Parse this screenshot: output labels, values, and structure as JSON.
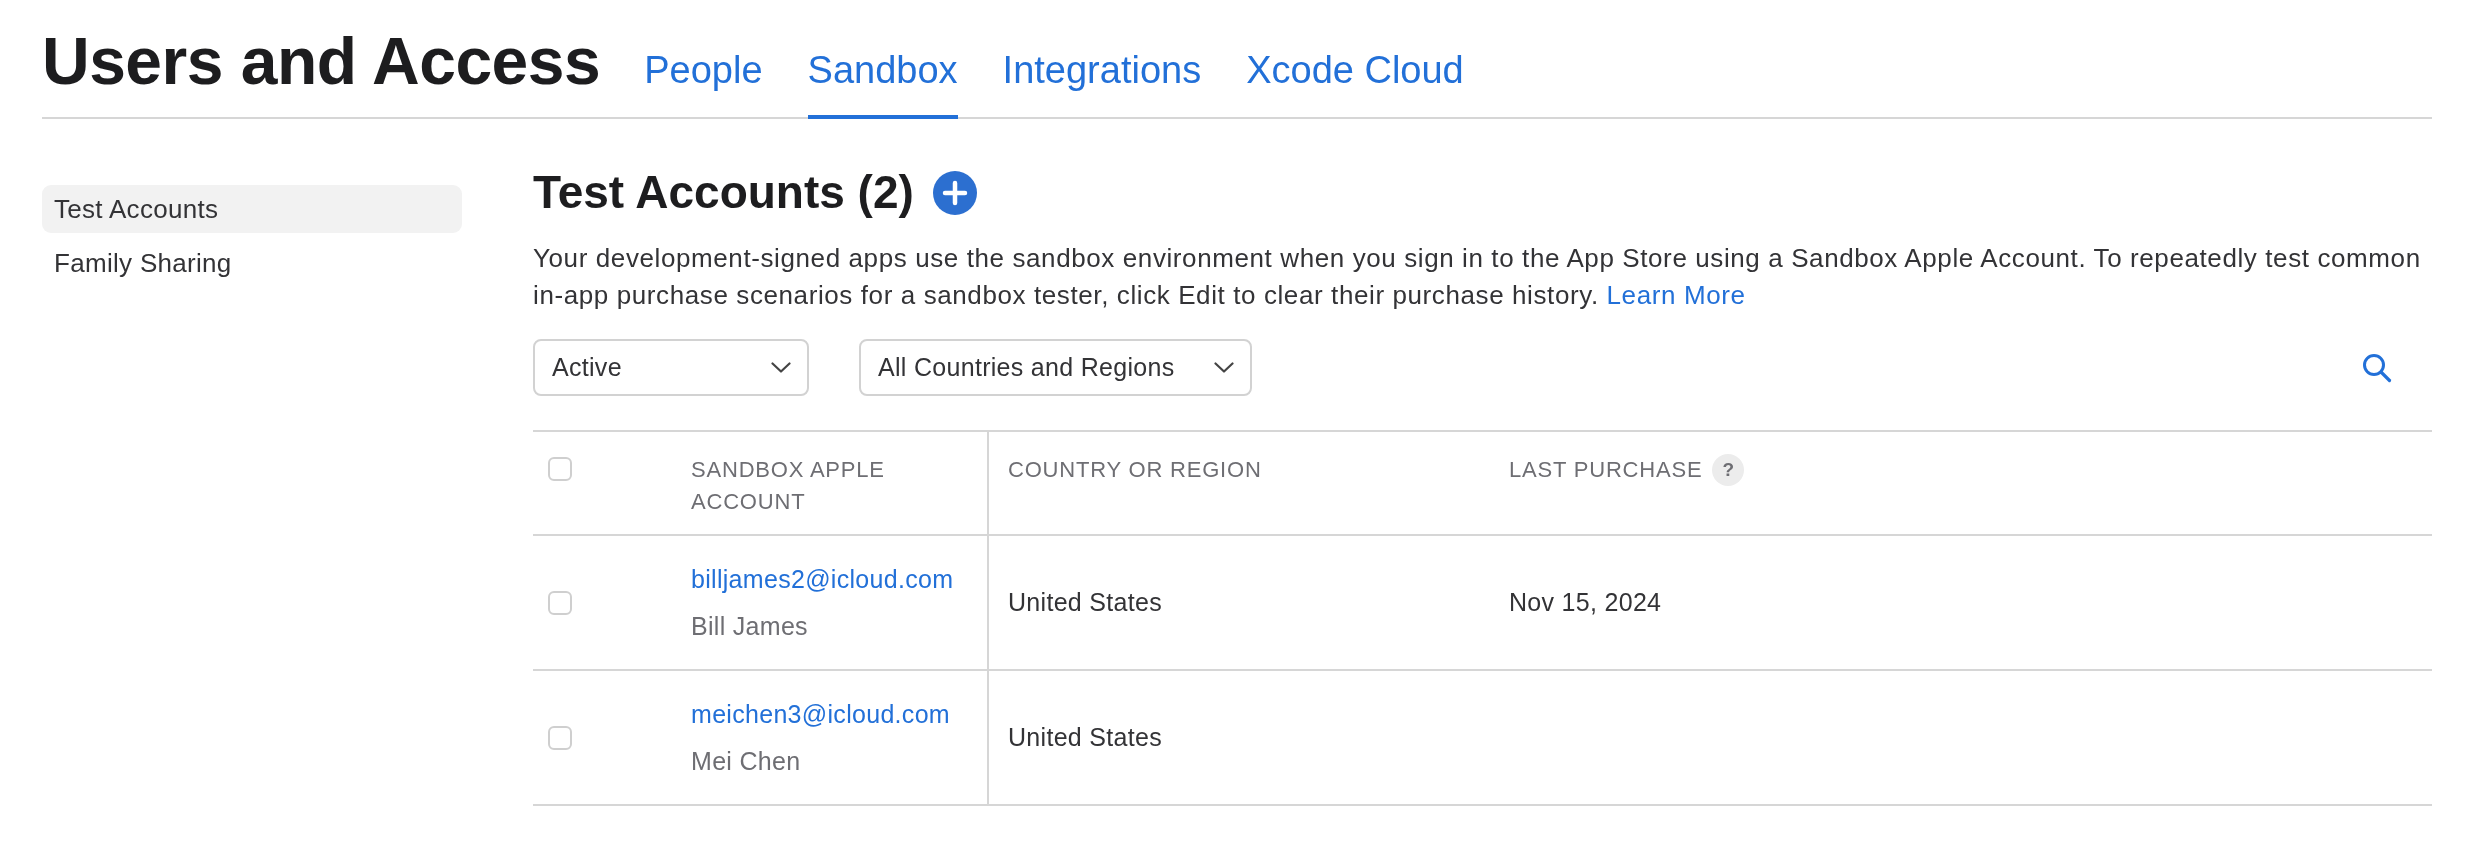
{
  "header": {
    "title": "Users and Access",
    "tabs": [
      {
        "label": "People",
        "selected": false
      },
      {
        "label": "Sandbox",
        "selected": true
      },
      {
        "label": "Integrations",
        "selected": false
      },
      {
        "label": "Xcode Cloud",
        "selected": false
      }
    ]
  },
  "sidebar": {
    "items": [
      {
        "label": "Test Accounts",
        "selected": true
      },
      {
        "label": "Family Sharing",
        "selected": false
      }
    ]
  },
  "main": {
    "title": "Test Accounts (2)",
    "description": "Your development-signed apps use the sandbox environment when you sign in to the App Store using a Sandbox Apple Account. To repeatedly test common in-app purchase scenarios for a sandbox tester, click Edit to clear their purchase history.",
    "learn_more_link": "Learn More",
    "filters": [
      {
        "value": "Active"
      },
      {
        "value": "All Countries and Regions"
      }
    ],
    "table": {
      "select_all_checked": false,
      "columns": [
        {
          "label": "SANDBOX APPLE ACCOUNT"
        },
        {
          "label": "COUNTRY OR REGION"
        },
        {
          "label": "LAST PURCHASE",
          "help": "?"
        }
      ],
      "rows": [
        {
          "checked": false,
          "email": "billjames2@icloud.com",
          "name": "Bill James",
          "country": "United States",
          "last_purchase": "Nov 15, 2024"
        },
        {
          "checked": false,
          "email": "meichen3@icloud.com",
          "name": "Mei Chen",
          "country": "United States"
        }
      ]
    }
  }
}
